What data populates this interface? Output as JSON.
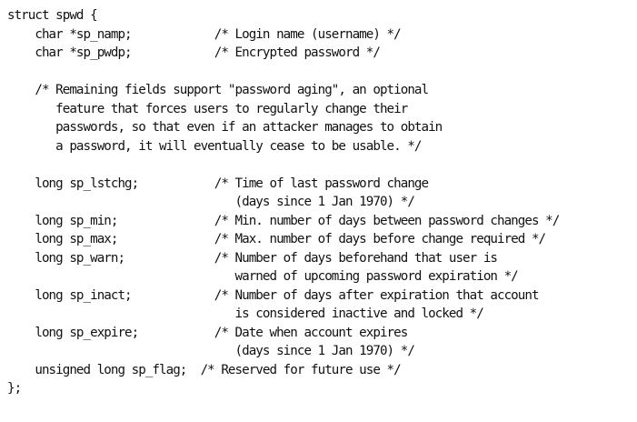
{
  "document": {
    "lines": [
      "struct spwd {",
      "    char *sp_namp;            /* Login name (username) */",
      "    char *sp_pwdp;            /* Encrypted password */",
      "",
      "    /* Remaining fields support \"password aging\", an optional",
      "       feature that forces users to regularly change their",
      "       passwords, so that even if an attacker manages to obtain",
      "       a password, it will eventually cease to be usable. */",
      "",
      "    long sp_lstchg;           /* Time of last password change",
      "                                 (days since 1 Jan 1970) */",
      "    long sp_min;              /* Min. number of days between password changes */",
      "    long sp_max;              /* Max. number of days before change required */",
      "    long sp_warn;             /* Number of days beforehand that user is",
      "                                 warned of upcoming password expiration */",
      "    long sp_inact;            /* Number of days after expiration that account",
      "                                 is considered inactive and locked */",
      "    long sp_expire;           /* Date when account expires",
      "                                 (days since 1 Jan 1970) */",
      "    unsigned long sp_flag;  /* Reserved for future use */",
      "};"
    ]
  }
}
